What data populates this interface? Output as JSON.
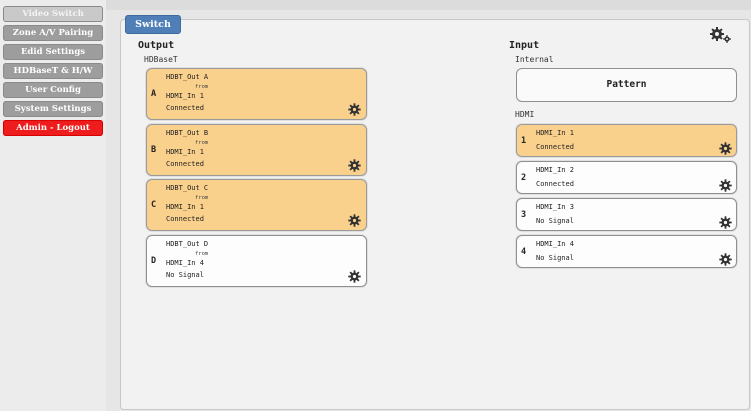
{
  "sidebar": {
    "items": [
      {
        "label": "Video Switch"
      },
      {
        "label": "Zone A/V Pairing"
      },
      {
        "label": "Edid Settings"
      },
      {
        "label": "HDBaseT & H/W"
      },
      {
        "label": "User Config"
      },
      {
        "label": "System Settings"
      },
      {
        "label": "Admin - Logout"
      }
    ]
  },
  "toolbar": {
    "switch_label": "Switch",
    "settings_icon": "gears-icon"
  },
  "output": {
    "heading": "Output",
    "group": "HDBaseT",
    "cards": [
      {
        "letter": "A",
        "name": "HDBT_Out A",
        "from": "from",
        "source": "HDMI_In 1",
        "status": "Connected"
      },
      {
        "letter": "B",
        "name": "HDBT_Out B",
        "from": "from",
        "source": "HDMI_In 1",
        "status": "Connected"
      },
      {
        "letter": "C",
        "name": "HDBT_Out C",
        "from": "from",
        "source": "HDMI_In 1",
        "status": "Connected"
      },
      {
        "letter": "D",
        "name": "HDBT_Out D",
        "from": "from",
        "source": "HDMI_In 4",
        "status": "No Signal"
      }
    ]
  },
  "input": {
    "heading": "Input",
    "internal_label": "Internal",
    "pattern_label": "Pattern",
    "hdmi_label": "HDMI",
    "cards": [
      {
        "num": "1",
        "name": "HDMI_In 1",
        "status": "Connected"
      },
      {
        "num": "2",
        "name": "HDMI_In 2",
        "status": "Connected"
      },
      {
        "num": "3",
        "name": "HDMI_In 3",
        "status": "No Signal"
      },
      {
        "num": "4",
        "name": "HDMI_In 4",
        "status": "No Signal"
      }
    ]
  },
  "colors": {
    "selected": "#fad08d",
    "accent": "#4f7fb6",
    "logout": "#ee1c1c",
    "nav": "#9d9d9d"
  }
}
